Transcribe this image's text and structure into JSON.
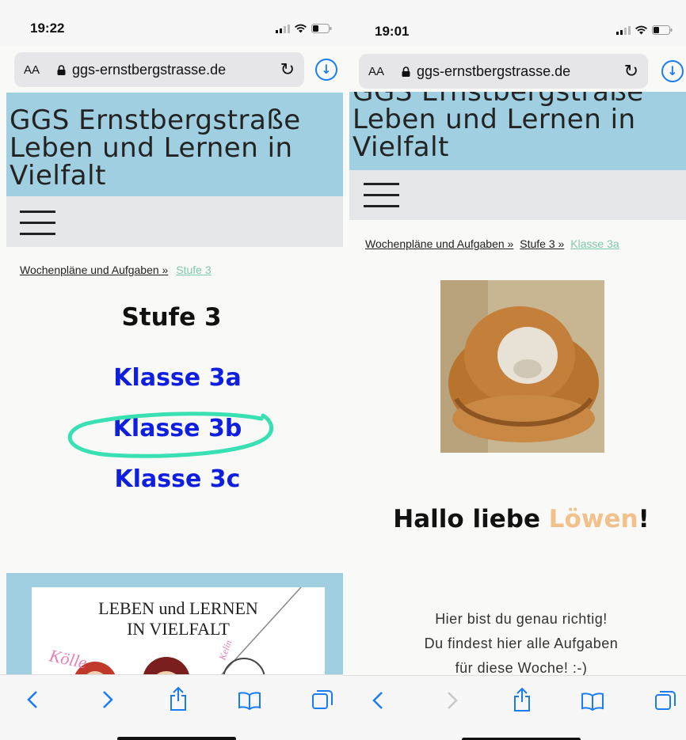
{
  "left": {
    "status_time": "19:22",
    "url_aa": "AA",
    "url": "ggs-ernstbergstrasse.de",
    "header_title_lines": [
      "GGS Ernstbergstraße",
      "Leben und Lernen in",
      "Vielfalt"
    ],
    "breadcrumb": {
      "parent": "Wochenpläne und Aufgaben »",
      "current": "Stufe 3"
    },
    "page_heading": "Stufe 3",
    "class_links": [
      "Klasse 3a",
      "Klasse 3b",
      "Klasse 3c"
    ],
    "banner_lines": [
      "LEBEN und LERNEN",
      "IN VIELFALT"
    ],
    "banner_scribbles": [
      "Kölle",
      "Kelin"
    ]
  },
  "right": {
    "status_time": "19:01",
    "url_aa": "AA",
    "url": "ggs-ernstbergstrasse.de",
    "header_title_lines": [
      "GGS Ernstbergstraße",
      "Leben und Lernen in",
      "Vielfalt"
    ],
    "breadcrumb": {
      "parent": "Wochenpläne und Aufgaben »",
      "middle": "Stufe 3 »",
      "current": "Klasse 3a"
    },
    "greeting": {
      "prefix": "Hallo liebe ",
      "highlight": "Löwen",
      "suffix": "!"
    },
    "body_lines": [
      "Hier bist du genau richtig!",
      "Du findest hier alle Aufgaben",
      "für diese Woche! :-)"
    ]
  },
  "colors": {
    "header_bg": "#9fcfe0",
    "menubar_bg": "#e6e7e8",
    "link_blue": "#0f1fe0",
    "breadcrumb_current": "#7fc9a9",
    "highlight_circle": "#39e0b4",
    "loewen": "#f2c08a",
    "safari_blue": "#1a7cf5"
  },
  "icons": {
    "nav": [
      "back-arrow-icon",
      "forward-arrow-icon",
      "share-icon",
      "bookmarks-icon",
      "tabs-icon"
    ]
  }
}
